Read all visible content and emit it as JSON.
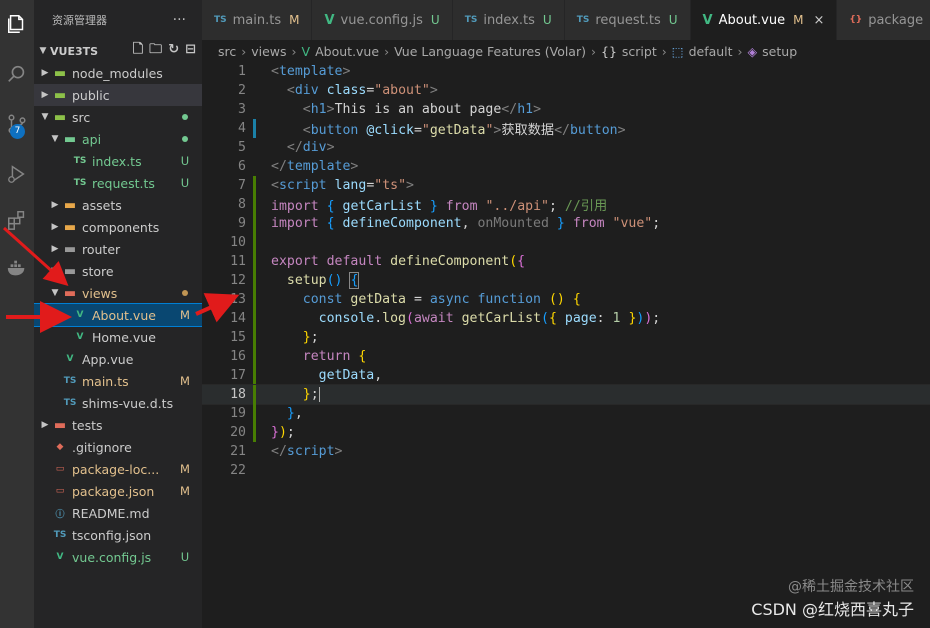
{
  "sidebar": {
    "header": "资源管理器",
    "more": "···",
    "project": "VUE3TS",
    "tree": [
      {
        "name": "node_modules",
        "type": "folder",
        "depth": 1,
        "open": false,
        "color": "#8dc149",
        "deco": ""
      },
      {
        "name": "public",
        "type": "folder",
        "depth": 1,
        "open": false,
        "color": "#8dc149",
        "deco": "",
        "sel": true
      },
      {
        "name": "src",
        "type": "folder",
        "depth": 1,
        "open": true,
        "color": "#8dc149",
        "deco": "dot",
        "decoColor": "#73c991"
      },
      {
        "name": "api",
        "type": "folder",
        "depth": 2,
        "open": true,
        "color": "#73c991",
        "deco": "dot",
        "decoColor": "#73c991",
        "nameColor": "#73c991"
      },
      {
        "name": "index.ts",
        "type": "ts",
        "depth": 3,
        "color": "#73c991",
        "deco": "U",
        "decoColor": "#73c991",
        "nameColor": "#73c991"
      },
      {
        "name": "request.ts",
        "type": "ts",
        "depth": 3,
        "color": "#73c991",
        "deco": "U",
        "decoColor": "#73c991",
        "nameColor": "#73c991"
      },
      {
        "name": "assets",
        "type": "folder",
        "depth": 2,
        "open": false,
        "color": "#e8a84a",
        "deco": ""
      },
      {
        "name": "components",
        "type": "folder",
        "depth": 2,
        "open": false,
        "color": "#e8a84a",
        "deco": ""
      },
      {
        "name": "router",
        "type": "folder",
        "depth": 2,
        "open": false,
        "color": "#999999",
        "deco": ""
      },
      {
        "name": "store",
        "type": "folder",
        "depth": 2,
        "open": false,
        "color": "#999999",
        "deco": ""
      },
      {
        "name": "views",
        "type": "folder",
        "depth": 2,
        "open": true,
        "color": "#e06c5a",
        "deco": "dot",
        "decoColor": "#c09553",
        "nameColor": "#e2c08d"
      },
      {
        "name": "About.vue",
        "type": "vue",
        "depth": 3,
        "color": "#41b883",
        "deco": "M",
        "decoColor": "#e2c08d",
        "nameColor": "#e2c08d",
        "active": true
      },
      {
        "name": "Home.vue",
        "type": "vue",
        "depth": 3,
        "color": "#41b883",
        "deco": ""
      },
      {
        "name": "App.vue",
        "type": "vue",
        "depth": 2,
        "color": "#41b883",
        "deco": ""
      },
      {
        "name": "main.ts",
        "type": "ts",
        "depth": 2,
        "color": "#519aba",
        "deco": "M",
        "decoColor": "#e2c08d",
        "nameColor": "#e2c08d"
      },
      {
        "name": "shims-vue.d.ts",
        "type": "ts",
        "depth": 2,
        "color": "#519aba",
        "deco": ""
      },
      {
        "name": "tests",
        "type": "folder",
        "depth": 1,
        "open": false,
        "color": "#e06c5a",
        "deco": ""
      },
      {
        "name": ".gitignore",
        "type": "git",
        "depth": 1,
        "color": "#e06c5a",
        "deco": ""
      },
      {
        "name": "package-loc...",
        "type": "pkg",
        "depth": 1,
        "color": "#e06c5a",
        "deco": "M",
        "decoColor": "#e2c08d",
        "nameColor": "#e2c08d"
      },
      {
        "name": "package.json",
        "type": "pkg",
        "depth": 1,
        "color": "#e06c5a",
        "deco": "M",
        "decoColor": "#e2c08d",
        "nameColor": "#e2c08d"
      },
      {
        "name": "README.md",
        "type": "md",
        "depth": 1,
        "color": "#519aba",
        "deco": ""
      },
      {
        "name": "tsconfig.json",
        "type": "tsc",
        "depth": 1,
        "color": "#519aba",
        "deco": ""
      },
      {
        "name": "vue.config.js",
        "type": "vue",
        "depth": 1,
        "color": "#41b883",
        "deco": "U",
        "decoColor": "#73c991",
        "nameColor": "#73c991"
      }
    ]
  },
  "tabs": [
    {
      "icon": "TS",
      "name": "main.ts",
      "status": "M",
      "iconColor": "#519aba",
      "statusColor": "#e2c08d"
    },
    {
      "icon": "V",
      "name": "vue.config.js",
      "status": "U",
      "iconColor": "#41b883",
      "statusColor": "#73c991"
    },
    {
      "icon": "TS",
      "name": "index.ts",
      "status": "U",
      "iconColor": "#519aba",
      "statusColor": "#73c991"
    },
    {
      "icon": "TS",
      "name": "request.ts",
      "status": "U",
      "iconColor": "#519aba",
      "statusColor": "#73c991"
    },
    {
      "icon": "V",
      "name": "About.vue",
      "status": "M",
      "iconColor": "#41b883",
      "statusColor": "#e2c08d",
      "active": true,
      "close": "×"
    },
    {
      "icon": "{}",
      "name": "package",
      "status": "",
      "iconColor": "#e06c5a",
      "statusColor": ""
    }
  ],
  "breadcrumb": [
    "src",
    "views",
    "About.vue",
    "Vue Language Features (Volar)",
    "script",
    "default",
    "setup"
  ],
  "editor": {
    "current_line": 18,
    "lines": [
      {
        "n": 1,
        "g": "",
        "html": "<span class='t'>&lt;</span><span class='tag'>template</span><span class='t'>&gt;</span>"
      },
      {
        "n": 2,
        "g": "",
        "html": "  <span class='t'>&lt;</span><span class='tag'>div</span> <span class='at'>class</span>=<span class='str'>\"about\"</span><span class='t'>&gt;</span>"
      },
      {
        "n": 3,
        "g": "",
        "html": "    <span class='t'>&lt;</span><span class='tag'>h1</span><span class='t'>&gt;</span>This is an about page<span class='t'>&lt;/</span><span class='tag'>h1</span><span class='t'>&gt;</span>"
      },
      {
        "n": 4,
        "g": "mod",
        "html": "    <span class='t'>&lt;</span><span class='tag'>button</span> <span class='at'>@click</span>=<span class='str'>\"</span><span class='fn'>getData</span><span class='str'>\"</span><span class='t'>&gt;</span>获取数据<span class='t'>&lt;/</span><span class='tag'>button</span><span class='t'>&gt;</span>"
      },
      {
        "n": 5,
        "g": "",
        "html": "  <span class='t'>&lt;/</span><span class='tag'>div</span><span class='t'>&gt;</span>"
      },
      {
        "n": 6,
        "g": "",
        "html": "<span class='t'>&lt;/</span><span class='tag'>template</span><span class='t'>&gt;</span>"
      },
      {
        "n": 7,
        "g": "add",
        "html": "<span class='t'>&lt;</span><span class='tag'>script</span> <span class='at'>lang</span>=<span class='str'>\"ts\"</span><span class='t'>&gt;</span>"
      },
      {
        "n": 8,
        "g": "add",
        "html": "<span class='kw'>import</span> <span class='br3'>{</span> <span class='var'>getCarList</span> <span class='br3'>}</span> <span class='kw'>from</span> <span class='str'>\"../api\"</span>; <span class='cm'>//引用</span>"
      },
      {
        "n": 9,
        "g": "add",
        "html": "<span class='kw'>import</span> <span class='br3'>{</span> <span class='var'>defineComponent</span>, <span class='dim'>onMounted</span> <span class='br3'>}</span> <span class='kw'>from</span> <span class='str'>\"vue\"</span>;"
      },
      {
        "n": 10,
        "g": "add",
        "html": ""
      },
      {
        "n": 11,
        "g": "add",
        "html": "<span class='kw'>export</span> <span class='kw'>default</span> <span class='fn'>defineComponent</span><span class='br'>(</span><span class='br2'>{</span>"
      },
      {
        "n": 12,
        "g": "add",
        "html": "  <span class='fn'>setup</span><span class='br3'>()</span> <span class='br3' style='outline:1px solid #888'>{</span>"
      },
      {
        "n": 13,
        "g": "add",
        "html": "    <span class='kb'>const</span> <span class='fn'>getData</span> = <span class='kb'>async</span> <span class='kb'>function</span> <span class='br'>()</span> <span class='br'>{</span>"
      },
      {
        "n": 14,
        "g": "add",
        "html": "      <span class='var'>console</span>.<span class='fn'>log</span><span class='br2'>(</span><span class='kw'>await</span> <span class='fn'>getCarList</span><span class='br3'>(</span><span class='br'>{</span> <span class='var'>page</span>: <span class='num'>1</span> <span class='br'>}</span><span class='br3'>)</span><span class='br2'>)</span>;"
      },
      {
        "n": 15,
        "g": "add",
        "html": "    <span class='br'>}</span>;"
      },
      {
        "n": 16,
        "g": "add",
        "html": "    <span class='kw'>return</span> <span class='br'>{</span>"
      },
      {
        "n": 17,
        "g": "add",
        "html": "      <span class='var'>getData</span>,"
      },
      {
        "n": 18,
        "g": "add",
        "html": "    <span class='br'>}</span>;<span style='border-left:1px solid #aeafad'></span>"
      },
      {
        "n": 19,
        "g": "add",
        "html": "  <span class='br3'>}</span>,"
      },
      {
        "n": 20,
        "g": "add",
        "html": "<span class='br2'>}</span><span class='br'>)</span>;"
      },
      {
        "n": 21,
        "g": "",
        "html": "<span class='t'>&lt;/</span><span class='tag'>script</span><span class='t'>&gt;</span>"
      },
      {
        "n": 22,
        "g": "",
        "html": ""
      }
    ]
  },
  "watermark": {
    "line1": "@稀土掘金技术社区",
    "line2": "CSDN @红烧西喜丸子"
  },
  "activity": {
    "badge": "7"
  }
}
